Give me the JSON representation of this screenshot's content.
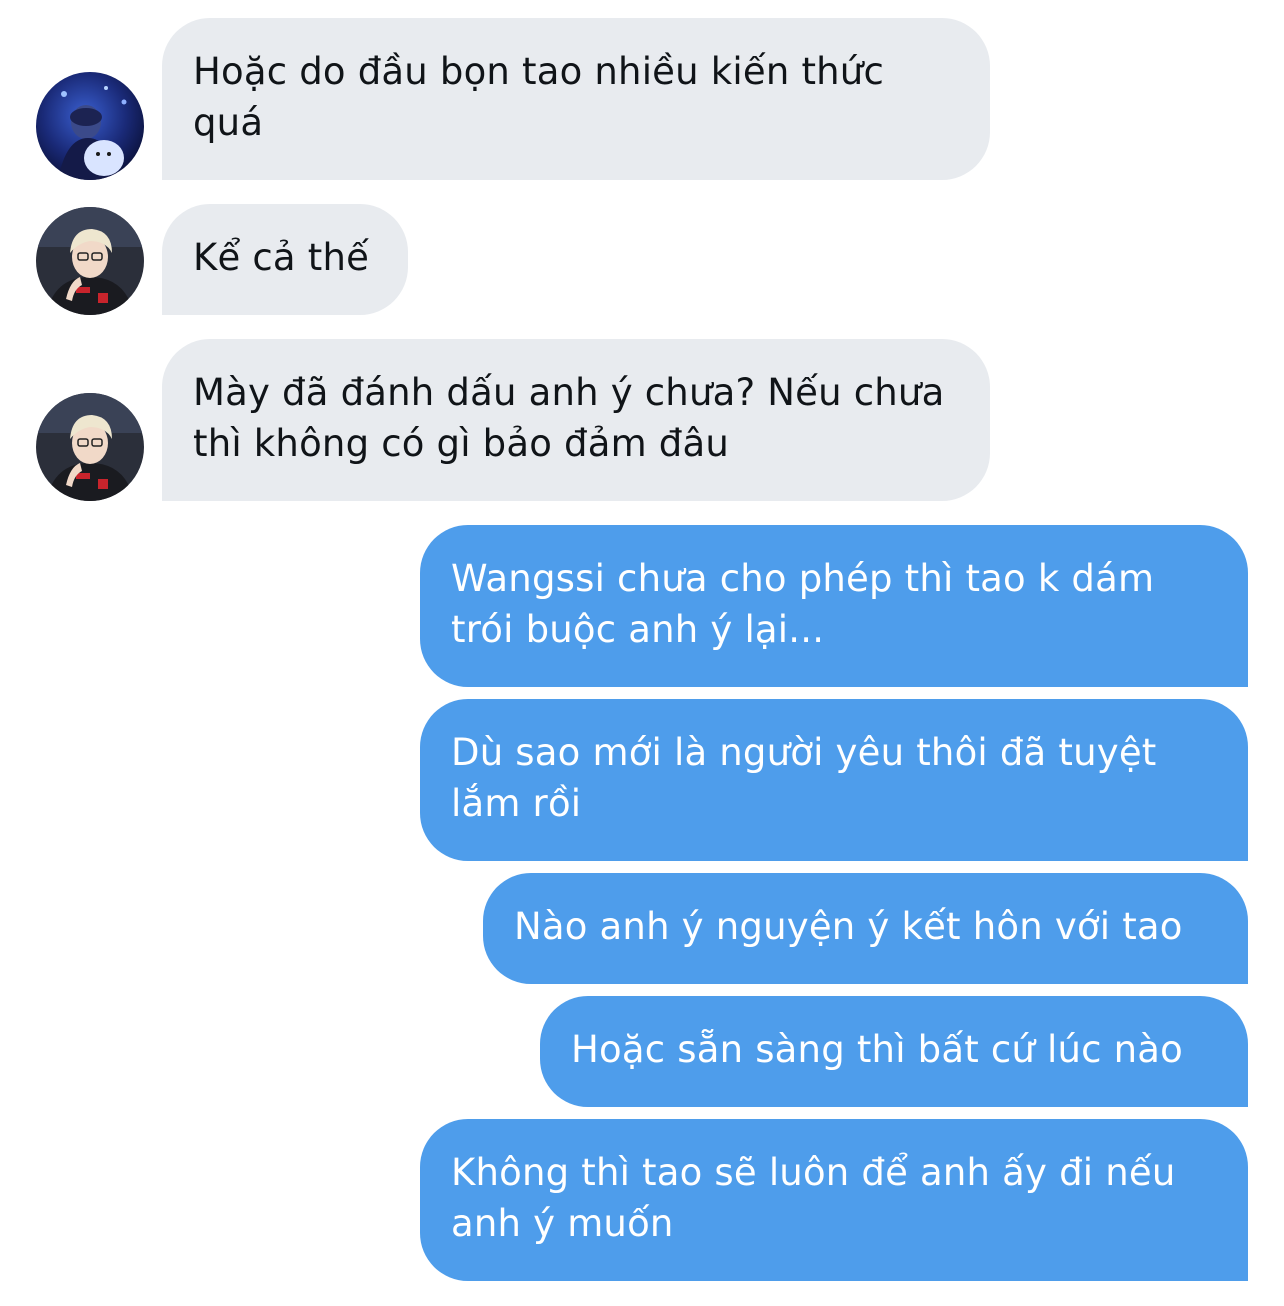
{
  "colors": {
    "incoming_bubble": "#e8ebef",
    "outgoing_bubble": "#4e9deb",
    "incoming_text": "#101418",
    "outgoing_text": "#ffffff",
    "background": "#ffffff"
  },
  "messages": [
    {
      "direction": "incoming",
      "avatar": "avatar-dark-blue-photo",
      "text": "Hoặc do đầu bọn tao nhiều kiến thức quá"
    },
    {
      "direction": "incoming",
      "avatar": "avatar-blonde-player-photo",
      "text": "Kể cả thế"
    },
    {
      "direction": "incoming",
      "avatar": "avatar-blonde-player-photo",
      "text": "Mày đã đánh dấu anh ý chưa? Nếu chưa thì không có gì bảo đảm đâu"
    },
    {
      "direction": "outgoing",
      "text": "Wangssi chưa cho phép thì tao k dám trói buộc anh ý lại..."
    },
    {
      "direction": "outgoing",
      "text": "Dù sao mới là người yêu thôi đã tuyệt lắm rồi"
    },
    {
      "direction": "outgoing",
      "text": "Nào anh ý nguyện ý kết hôn với tao"
    },
    {
      "direction": "outgoing",
      "text": "Hoặc sẵn sàng thì bất cứ lúc nào"
    },
    {
      "direction": "outgoing",
      "text": "Không thì tao sẽ luôn để anh ấy đi nếu anh ý muốn"
    }
  ]
}
